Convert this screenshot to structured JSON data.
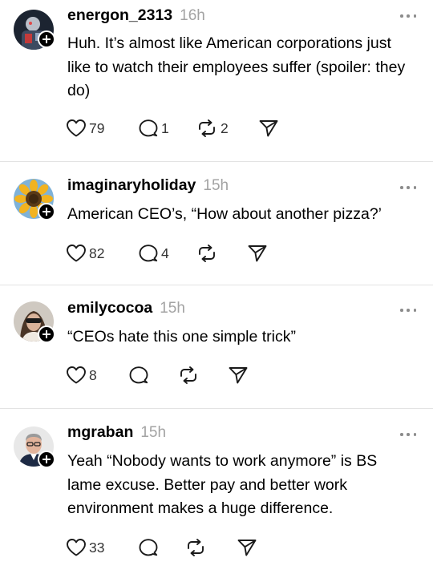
{
  "posts": [
    {
      "username": "energon_2313",
      "time": "16h",
      "text": "Huh. It’s almost like American corporations just like to watch their employees suffer (spoiler: they do)",
      "likes": "79",
      "replies": "1",
      "reposts": "2"
    },
    {
      "username": "imaginaryholiday",
      "time": "15h",
      "text": "American CEO’s, “How about another pizza?’",
      "likes": "82",
      "replies": "4",
      "reposts": ""
    },
    {
      "username": "emilycocoa",
      "time": "15h",
      "text": "“CEOs hate this one simple trick”",
      "likes": "8",
      "replies": "",
      "reposts": ""
    },
    {
      "username": "mgraban",
      "time": "15h",
      "text": "Yeah “Nobody wants to work anymore” is BS lame excuse. Better pay and better work environment makes a huge difference.",
      "likes": "33",
      "replies": "",
      "reposts": ""
    }
  ],
  "icons": {
    "like": "heart-icon",
    "reply": "speech-bubble-icon",
    "repost": "repost-arrows-icon",
    "share": "paper-plane-icon",
    "more": "ellipsis-icon",
    "follow": "plus-icon"
  },
  "colors": {
    "text": "#000000",
    "muted": "#a3a3a3",
    "icon": "#1a1a1a",
    "divider": "#e3e3e3"
  }
}
